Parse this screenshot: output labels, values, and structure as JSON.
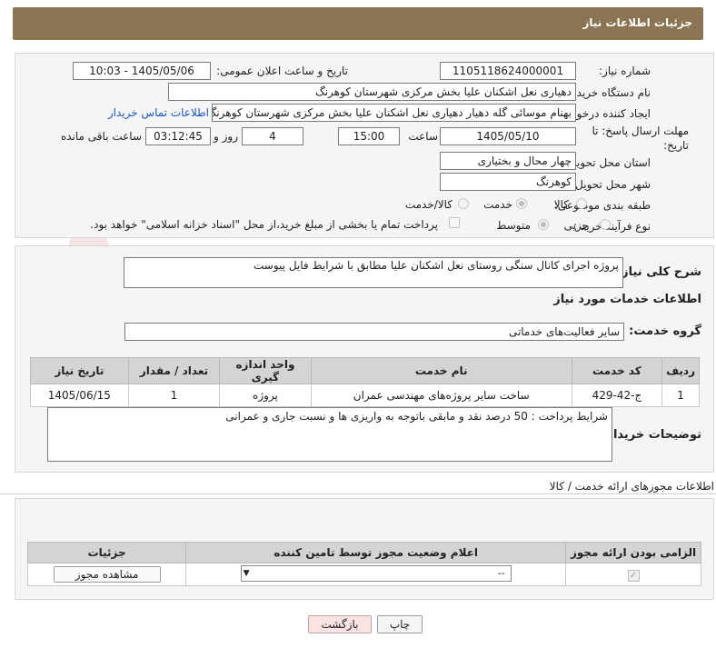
{
  "header": {
    "title": "جزئیات اطلاعات نیاز"
  },
  "form": {
    "need_number_label": "شماره نیاز:",
    "need_number": "1105118624000001",
    "announce_label": "تاریخ و ساعت اعلان عمومی:",
    "announce_value": "1405/05/06 - 10:03",
    "buyer_org_label": "نام دستگاه خریدار:",
    "buyer_org": "دهیاری نعل اشکنان علیا بخش مرکزی شهرستان کوهرنگ",
    "requester_label": "ایجاد کننده درخواست:",
    "requester": "بهنام موسائی گله دهیار دهیاری نعل اشکنان علیا بخش مرکزی شهرستان کوهرنگ",
    "contact_link": "اطلاعات تماس خریدار",
    "deadline_label": "مهلت ارسال پاسخ: تا تاریخ:",
    "deadline_date": "1405/05/10",
    "time_label": "ساعت",
    "deadline_time": "15:00",
    "days_value": "4",
    "days_label": "روز و",
    "remaining_value": "03:12:45",
    "remaining_label": "ساعت باقی مانده",
    "province_label": "استان محل تحویل:",
    "province": "چهار محال و بختیاری",
    "city_label": "شهر محل تحویل:",
    "city": "کوهرنگ",
    "category_label": "طبقه بندی موضوعی:",
    "category_options": [
      "کالا",
      "خدمت",
      "کالا/خدمت"
    ],
    "process_label": "نوع فرآیند خرید :",
    "process_options": [
      "جزیی",
      "متوسط"
    ],
    "payment_note": "پرداخت تمام یا بخشی از مبلغ خرید،از محل \"اسناد خزانه اسلامی\" خواهد بود."
  },
  "details": {
    "summary_label": "شرح کلی نیاز:",
    "summary": "پروژه اجرای کانال سنگی روستای نعل اشکنان علیا مطابق با شرایط فایل پیوست",
    "services_title": "اطلاعات خدمات مورد نیاز",
    "service_group_label": "گروه خدمت:",
    "service_group": "سایر فعالیت‌های خدماتی",
    "table": {
      "headers": [
        "ردیف",
        "کد خدمت",
        "نام خدمت",
        "واحد اندازه گیری",
        "تعداد / مقدار",
        "تاریخ نیاز"
      ],
      "rows": [
        [
          "1",
          "ج-42-429",
          "ساخت سایر پروژه‌های مهندسی عمران",
          "پروژه",
          "1",
          "1405/06/15"
        ]
      ]
    },
    "buyer_notes_label": "توضیحات خریدار:",
    "buyer_notes": "شرایط پرداخت : 50 درصد نقد و مابقی باتوجه به واریزی ها و نسبت جاری و عمرانی"
  },
  "permits": {
    "title": "اطلاعات مجوزهای ارائه خدمت / کالا",
    "headers": [
      "الزامی بودن ارائه مجوز",
      "اعلام وضعیت مجوز توسط تامین کننده",
      "جزئیات"
    ],
    "select_value": "--",
    "view_button": "مشاهده مجوز"
  },
  "buttons": {
    "print": "چاپ",
    "back": "بازگشت"
  },
  "watermark_text": "AriaTender.net"
}
